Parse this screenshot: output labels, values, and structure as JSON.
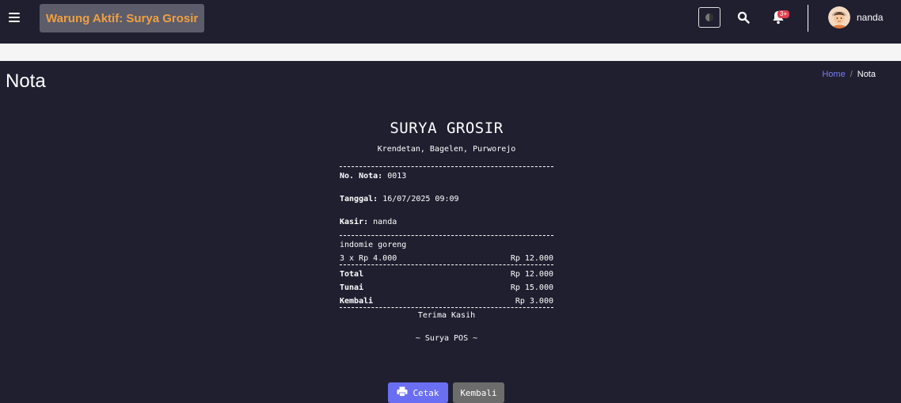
{
  "header": {
    "store_badge": "Warung Aktif: Surya Grosir",
    "notification_count": "3+",
    "username": "nanda"
  },
  "page": {
    "title": "Nota",
    "breadcrumb": {
      "home": "Home",
      "separator": "/",
      "current": "Nota"
    }
  },
  "receipt": {
    "store_name": "SURYA GROSIR",
    "address": "Krendetan, Bagelen, Purworejo",
    "no_nota_label": "No. Nota:",
    "no_nota_value": "0013",
    "tanggal_label": "Tanggal:",
    "tanggal_value": "16/07/2025 09:09",
    "kasir_label": "Kasir:",
    "kasir_value": "nanda",
    "items": [
      {
        "name": "indomie goreng",
        "qty_price": "3 x Rp 4.000",
        "subtotal": "Rp 12.000"
      }
    ],
    "total_label": "Total",
    "total_value": "Rp 12.000",
    "tunai_label": "Tunai",
    "tunai_value": "Rp 15.000",
    "kembali_label": "Kembali",
    "kembali_value": "Rp 3.000",
    "thanks": "Terima Kasih",
    "footer": "~ Surya POS ~"
  },
  "actions": {
    "print_label": "Cetak",
    "back_label": "Kembali"
  },
  "colors": {
    "background": "#201f30",
    "badge_text": "#f0a040",
    "print_button": "#6a6ef2",
    "back_button": "#6c6c6c",
    "notification_badge": "#e04050",
    "breadcrumb_link": "#7b7bf0"
  }
}
